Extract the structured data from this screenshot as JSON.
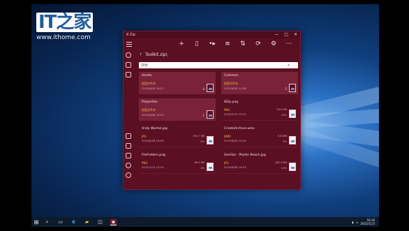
{
  "watermark": {
    "logo_text": "IT之家",
    "url": "www.ithome.com"
  },
  "window": {
    "title": "8 Zip",
    "controls": {
      "minimize": "—",
      "maximize": "□",
      "close": "✕"
    }
  },
  "toolbar": {
    "icons": [
      "plus-icon",
      "new-file-icon",
      "arrow-right-icon",
      "list-view-icon",
      "sort-icon",
      "share-icon",
      "settings-icon",
      "more-icon"
    ],
    "glyphs": [
      "+",
      "▯",
      "•▸",
      "≡",
      "⇅",
      "⟳",
      "⚙",
      "⋯"
    ]
  },
  "breadcrumb": {
    "path": "Toolkit.zip\\"
  },
  "search": {
    "placeholder": "搜索"
  },
  "items": [
    {
      "name": "Assets",
      "kind": "folder",
      "type": "档案文件夹",
      "date": "2015/8/28 16:27",
      "count": "4"
    },
    {
      "name": "Common",
      "kind": "folder",
      "type": "档案文件夹",
      "date": "2015/8/28 11:08",
      "count": "5"
    },
    {
      "name": "Properties",
      "kind": "folder",
      "type": "档案文件夹",
      "date": "2015/8/28 16:27",
      "count": "1"
    },
    {
      "name": "8Zip.png",
      "kind": "file",
      "type": "PNG",
      "date": "2015/11/3 13:13",
      "size": "25.8 KB",
      "pct": "72%"
    },
    {
      "name": "Andy Warhol.jpg",
      "kind": "file",
      "type": "JPG",
      "date": "2015/8/28 16:03",
      "size": "150.7 KB",
      "pct": "3%"
    },
    {
      "name": "CreateArchive.wmv",
      "kind": "file",
      "type": "WMV",
      "date": "2015/8/28 15:44",
      "size": "5.8 MB",
      "pct": "3%"
    },
    {
      "name": "FileFolders.png",
      "kind": "file",
      "type": "PNG",
      "date": "2015/11/3 13:13",
      "size": "96.2 KB",
      "pct": "1%"
    },
    {
      "name": "Gorillaz - Plastic Beach.jpg",
      "kind": "file",
      "type": "JPG",
      "date": "2015/8/28 16:03",
      "size": "182.9 KB",
      "pct": "14%"
    }
  ],
  "taskbar": {
    "start_glyph": "⊞",
    "icons": [
      "search-icon",
      "task-view-icon",
      "edge-icon",
      "explorer-icon",
      "store-icon",
      "8zip-icon"
    ],
    "glyphs": [
      "⌕",
      "▭",
      "e",
      "▰",
      "◫",
      "▪"
    ],
    "clock_time": "16:16",
    "clock_date": "2015/11/3"
  },
  "colors": {
    "accent": "#5b0f22",
    "folder_tile": "#7a2238",
    "type_label": "#f2b94a"
  }
}
